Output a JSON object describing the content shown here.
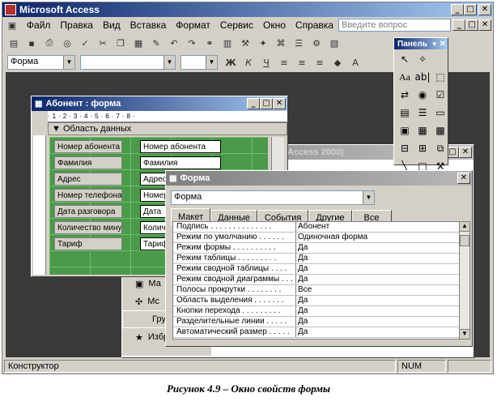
{
  "app": {
    "title": "Microsoft Access"
  },
  "menu": [
    "Файл",
    "Правка",
    "Вид",
    "Вставка",
    "Формат",
    "Сервис",
    "Окно",
    "Справка"
  ],
  "ask_placeholder": "Введите вопрос",
  "object_combo": "Форма",
  "toolbox": {
    "title": "Панель"
  },
  "background_window": {
    "title": "Access 2000)"
  },
  "nav_items": [
    "Ма",
    "Мс",
    "Гру",
    "Избранное"
  ],
  "form_window": {
    "title": "Абонент : форма",
    "section": "Область данных",
    "rows": [
      {
        "label": "Номер абонента",
        "field": "Номер абонента"
      },
      {
        "label": "Фамилия",
        "field": "Фамилия"
      },
      {
        "label": "Адрес",
        "field": "Адрес"
      },
      {
        "label": "Номер телефона",
        "field": "Номер"
      },
      {
        "label": "Дата разговора",
        "field": "Дата"
      },
      {
        "label": "Количество минут",
        "field": "Количество"
      },
      {
        "label": "Тариф",
        "field": "Тариф"
      }
    ]
  },
  "props": {
    "title": "Форма",
    "selector": "Форма",
    "tabs": [
      "Макет",
      "Данные",
      "События",
      "Другие",
      "Все"
    ],
    "rows": [
      {
        "name": "Подпись . . . . . . . . . . . . . .",
        "value": "Абонент"
      },
      {
        "name": "Режим по умолчанию . . . . . .",
        "value": "Одиночная форма"
      },
      {
        "name": "Режим формы . . . . . . . . . .",
        "value": "Да"
      },
      {
        "name": "Режим таблицы . . . . . . . . .",
        "value": "Да"
      },
      {
        "name": "Режим сводной таблицы . . . .",
        "value": "Да"
      },
      {
        "name": "Режим сводной диаграммы . . .",
        "value": "Да"
      },
      {
        "name": "Полосы прокрутки . . . . . . . .",
        "value": "Все"
      },
      {
        "name": "Область выделения . . . . . . .",
        "value": "Да"
      },
      {
        "name": "Кнопки перехода . . . . . . . . .",
        "value": "Да"
      },
      {
        "name": "Разделительные линии . . . . .",
        "value": "Да"
      },
      {
        "name": "Автоматический размер . . . . .",
        "value": "Да"
      }
    ]
  },
  "status": {
    "left": "Конструктор",
    "right": "NUM"
  },
  "caption": "Рисунок 4.9 – Окно свойств формы"
}
